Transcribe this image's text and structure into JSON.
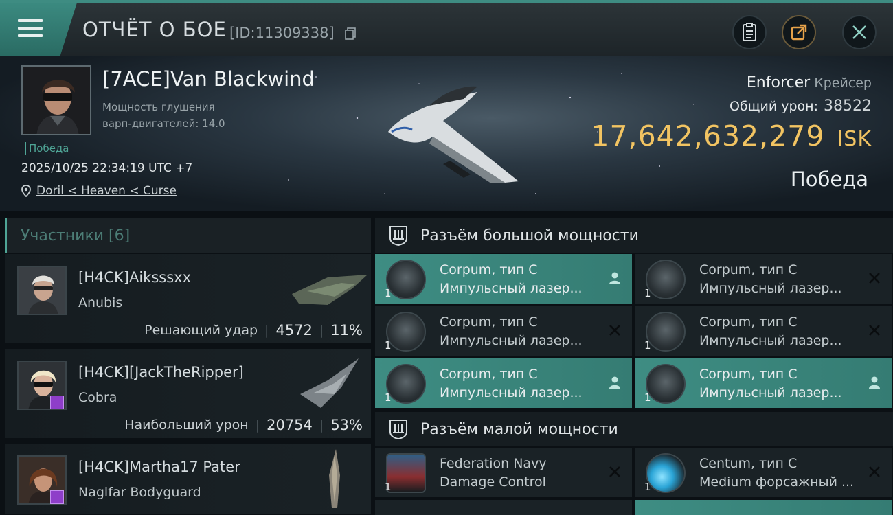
{
  "header": {
    "title": "ОТЧЁТ О БОЕ",
    "report_id": "[ID:11309338]"
  },
  "player": {
    "name": "[7ACE]Van Blackwind",
    "warp_line1": "Мощность глушения",
    "warp_line2": "варп-двигателей: 14.0",
    "result_tag": "Победа",
    "datetime": "2025/10/25 22:34:19 UTC +7",
    "location": "Doril < Heaven < Curse"
  },
  "victim_ship": {
    "name": "Enforcer",
    "class": "Крейсер",
    "damage_label": "Общий урон:",
    "damage_value": "38522",
    "isk_value": "17,642,632,279",
    "isk_unit": "ISK",
    "result": "Победа"
  },
  "participants": {
    "header": "Участники [6]",
    "items": [
      {
        "name": "[H4CK]Aiksssxx",
        "ship": "Anubis",
        "stat_label": "Решающий удар",
        "stat_value": "4572",
        "stat_percent": "11%"
      },
      {
        "name": "[H4CK][JackTheRipper]",
        "ship": "Cobra",
        "stat_label": "Наибольший урон",
        "stat_value": "20754",
        "stat_percent": "53%"
      },
      {
        "name": "[H4CK]Martha17 Pater",
        "ship": "Naglfar Bodyguard"
      }
    ]
  },
  "high_slots": {
    "title": "Разъём большой мощности",
    "modules": [
      {
        "line1": "Corpum, тип C",
        "line2": "Импульсный лазер...",
        "qty": "1",
        "state": "pilot-icon"
      },
      {
        "line1": "Corpum, тип C",
        "line2": "Импульсный лазер...",
        "qty": "1",
        "state": "destroyed-icon"
      },
      {
        "line1": "Corpum, тип C",
        "line2": "Импульсный лазер...",
        "qty": "1",
        "state": "destroyed-icon"
      },
      {
        "line1": "Corpum, тип C",
        "line2": "Импульсный лазер...",
        "qty": "1",
        "state": "destroyed-icon"
      },
      {
        "line1": "Corpum, тип C",
        "line2": "Импульсный лазер...",
        "qty": "1",
        "state": "pilot-icon"
      },
      {
        "line1": "Corpum, тип C",
        "line2": "Импульсный лазер...",
        "qty": "1",
        "state": "pilot-icon"
      }
    ]
  },
  "low_slots": {
    "title": "Разъём малой мощности",
    "modules": [
      {
        "line1": "Federation Navy",
        "line2": "Damage Control",
        "qty": "1",
        "state": "destroyed-icon"
      },
      {
        "line1": "Centum, тип C",
        "line2": "Medium форсажный ...",
        "qty": "1",
        "state": "destroyed-icon"
      }
    ]
  },
  "colors": {
    "accent": "#3e8d83",
    "isk": "#f2c462",
    "victory": "#4fa596"
  }
}
